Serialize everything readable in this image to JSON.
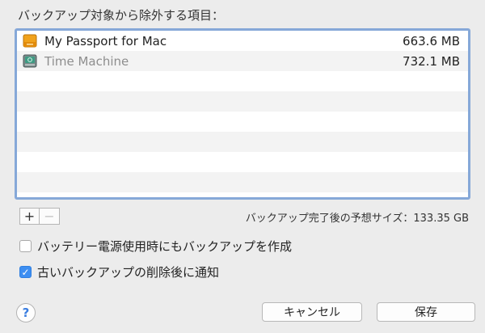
{
  "heading": "バックアップ対象から除外する項目：",
  "exclusions": [
    {
      "name": "My Passport for Mac",
      "size": "663.6 MB",
      "icon": "external-drive-icon",
      "dimmed": false
    },
    {
      "name": "Time Machine",
      "size": "732.1 MB",
      "icon": "time-machine-disk-icon",
      "dimmed": true
    }
  ],
  "controls": {
    "add_label": "+",
    "remove_label": "−"
  },
  "estimate": "バックアップ完了後の予想サイズ：133.35 GB",
  "options": [
    {
      "label": "バッテリー電源使用時にもバックアップを作成",
      "checked": false
    },
    {
      "label": "古いバックアップの削除後に通知",
      "checked": true
    }
  ],
  "help_label": "?",
  "buttons": {
    "cancel": "キャンセル",
    "save": "保存"
  },
  "colors": {
    "accent": "#3d8ef1",
    "list_border": "#86a8d8",
    "drive_orange": "#f0a21c"
  }
}
